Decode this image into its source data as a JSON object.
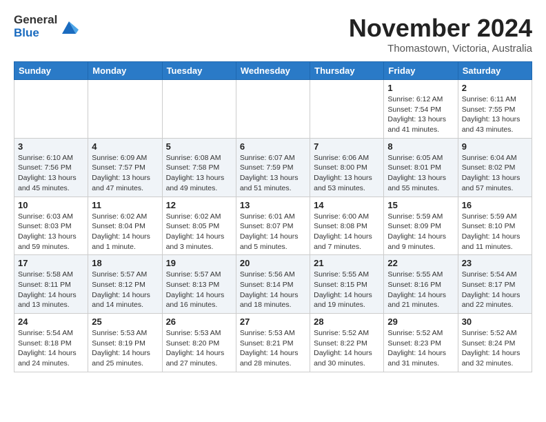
{
  "header": {
    "logo_line1": "General",
    "logo_line2": "Blue",
    "month": "November 2024",
    "location": "Thomastown, Victoria, Australia"
  },
  "days_of_week": [
    "Sunday",
    "Monday",
    "Tuesday",
    "Wednesday",
    "Thursday",
    "Friday",
    "Saturday"
  ],
  "weeks": [
    [
      {
        "day": "",
        "info": ""
      },
      {
        "day": "",
        "info": ""
      },
      {
        "day": "",
        "info": ""
      },
      {
        "day": "",
        "info": ""
      },
      {
        "day": "",
        "info": ""
      },
      {
        "day": "1",
        "info": "Sunrise: 6:12 AM\nSunset: 7:54 PM\nDaylight: 13 hours\nand 41 minutes."
      },
      {
        "day": "2",
        "info": "Sunrise: 6:11 AM\nSunset: 7:55 PM\nDaylight: 13 hours\nand 43 minutes."
      }
    ],
    [
      {
        "day": "3",
        "info": "Sunrise: 6:10 AM\nSunset: 7:56 PM\nDaylight: 13 hours\nand 45 minutes."
      },
      {
        "day": "4",
        "info": "Sunrise: 6:09 AM\nSunset: 7:57 PM\nDaylight: 13 hours\nand 47 minutes."
      },
      {
        "day": "5",
        "info": "Sunrise: 6:08 AM\nSunset: 7:58 PM\nDaylight: 13 hours\nand 49 minutes."
      },
      {
        "day": "6",
        "info": "Sunrise: 6:07 AM\nSunset: 7:59 PM\nDaylight: 13 hours\nand 51 minutes."
      },
      {
        "day": "7",
        "info": "Sunrise: 6:06 AM\nSunset: 8:00 PM\nDaylight: 13 hours\nand 53 minutes."
      },
      {
        "day": "8",
        "info": "Sunrise: 6:05 AM\nSunset: 8:01 PM\nDaylight: 13 hours\nand 55 minutes."
      },
      {
        "day": "9",
        "info": "Sunrise: 6:04 AM\nSunset: 8:02 PM\nDaylight: 13 hours\nand 57 minutes."
      }
    ],
    [
      {
        "day": "10",
        "info": "Sunrise: 6:03 AM\nSunset: 8:03 PM\nDaylight: 13 hours\nand 59 minutes."
      },
      {
        "day": "11",
        "info": "Sunrise: 6:02 AM\nSunset: 8:04 PM\nDaylight: 14 hours\nand 1 minute."
      },
      {
        "day": "12",
        "info": "Sunrise: 6:02 AM\nSunset: 8:05 PM\nDaylight: 14 hours\nand 3 minutes."
      },
      {
        "day": "13",
        "info": "Sunrise: 6:01 AM\nSunset: 8:07 PM\nDaylight: 14 hours\nand 5 minutes."
      },
      {
        "day": "14",
        "info": "Sunrise: 6:00 AM\nSunset: 8:08 PM\nDaylight: 14 hours\nand 7 minutes."
      },
      {
        "day": "15",
        "info": "Sunrise: 5:59 AM\nSunset: 8:09 PM\nDaylight: 14 hours\nand 9 minutes."
      },
      {
        "day": "16",
        "info": "Sunrise: 5:59 AM\nSunset: 8:10 PM\nDaylight: 14 hours\nand 11 minutes."
      }
    ],
    [
      {
        "day": "17",
        "info": "Sunrise: 5:58 AM\nSunset: 8:11 PM\nDaylight: 14 hours\nand 13 minutes."
      },
      {
        "day": "18",
        "info": "Sunrise: 5:57 AM\nSunset: 8:12 PM\nDaylight: 14 hours\nand 14 minutes."
      },
      {
        "day": "19",
        "info": "Sunrise: 5:57 AM\nSunset: 8:13 PM\nDaylight: 14 hours\nand 16 minutes."
      },
      {
        "day": "20",
        "info": "Sunrise: 5:56 AM\nSunset: 8:14 PM\nDaylight: 14 hours\nand 18 minutes."
      },
      {
        "day": "21",
        "info": "Sunrise: 5:55 AM\nSunset: 8:15 PM\nDaylight: 14 hours\nand 19 minutes."
      },
      {
        "day": "22",
        "info": "Sunrise: 5:55 AM\nSunset: 8:16 PM\nDaylight: 14 hours\nand 21 minutes."
      },
      {
        "day": "23",
        "info": "Sunrise: 5:54 AM\nSunset: 8:17 PM\nDaylight: 14 hours\nand 22 minutes."
      }
    ],
    [
      {
        "day": "24",
        "info": "Sunrise: 5:54 AM\nSunset: 8:18 PM\nDaylight: 14 hours\nand 24 minutes."
      },
      {
        "day": "25",
        "info": "Sunrise: 5:53 AM\nSunset: 8:19 PM\nDaylight: 14 hours\nand 25 minutes."
      },
      {
        "day": "26",
        "info": "Sunrise: 5:53 AM\nSunset: 8:20 PM\nDaylight: 14 hours\nand 27 minutes."
      },
      {
        "day": "27",
        "info": "Sunrise: 5:53 AM\nSunset: 8:21 PM\nDaylight: 14 hours\nand 28 minutes."
      },
      {
        "day": "28",
        "info": "Sunrise: 5:52 AM\nSunset: 8:22 PM\nDaylight: 14 hours\nand 30 minutes."
      },
      {
        "day": "29",
        "info": "Sunrise: 5:52 AM\nSunset: 8:23 PM\nDaylight: 14 hours\nand 31 minutes."
      },
      {
        "day": "30",
        "info": "Sunrise: 5:52 AM\nSunset: 8:24 PM\nDaylight: 14 hours\nand 32 minutes."
      }
    ]
  ]
}
